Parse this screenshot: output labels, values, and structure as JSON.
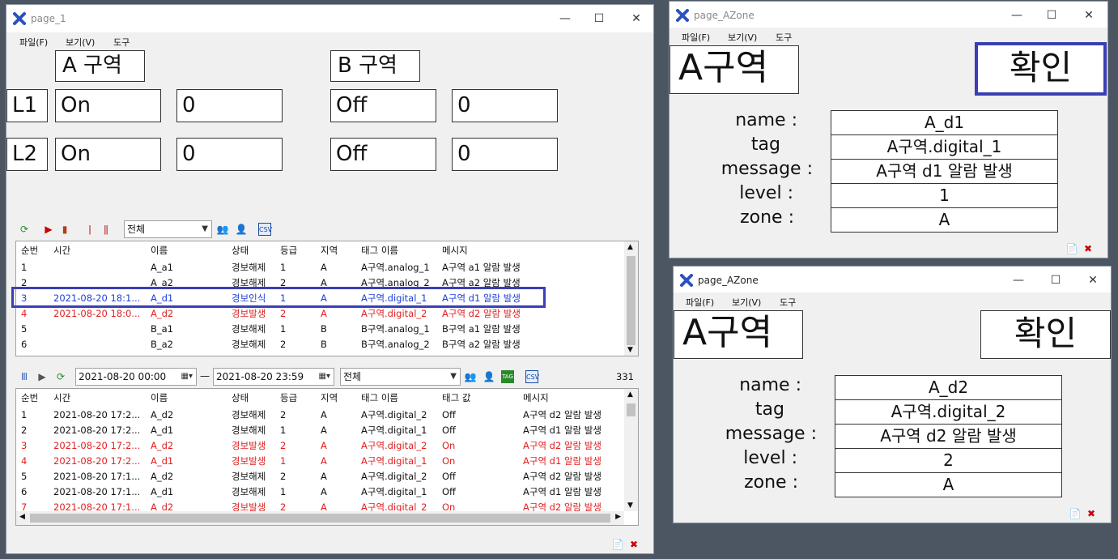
{
  "main_window": {
    "title": "page_1",
    "menu": [
      "파일(F)",
      "보기(V)",
      "도구"
    ],
    "zone_a_label": "A 구역",
    "zone_b_label": "B 구역",
    "rows": [
      {
        "label": "L1",
        "a_state": "On",
        "a_value": "0",
        "b_state": "Off",
        "b_value": "0"
      },
      {
        "label": "L2",
        "a_state": "On",
        "a_value": "0",
        "b_state": "Off",
        "b_value": "0"
      }
    ],
    "alarm_filter": "전체",
    "alarm_columns": [
      "순번",
      "시간",
      "이름",
      "상태",
      "등급",
      "지역",
      "태그 이름",
      "메시지"
    ],
    "alarm_rows": [
      {
        "c": [
          "1",
          "",
          "A_a1",
          "경보해제",
          "1",
          "A",
          "A구역.analog_1",
          "A구역 a1 알람 발생"
        ],
        "style": "normal"
      },
      {
        "c": [
          "2",
          "",
          "A_a2",
          "경보해제",
          "2",
          "A",
          "A구역.analog_2",
          "A구역 a2 알람 발생"
        ],
        "style": "normal"
      },
      {
        "c": [
          "3",
          "2021-08-20 18:1...",
          "A_d1",
          "경보인식",
          "1",
          "A",
          "A구역.digital_1",
          "A구역 d1 알람 발생"
        ],
        "style": "blue"
      },
      {
        "c": [
          "4",
          "2021-08-20 18:0...",
          "A_d2",
          "경보발생",
          "2",
          "A",
          "A구역.digital_2",
          "A구역 d2 알람 발생"
        ],
        "style": "red"
      },
      {
        "c": [
          "5",
          "",
          "B_a1",
          "경보해제",
          "1",
          "B",
          "B구역.analog_1",
          "B구역 a1 알람 발생"
        ],
        "style": "normal"
      },
      {
        "c": [
          "6",
          "",
          "B_a2",
          "경보해제",
          "2",
          "B",
          "B구역.analog_2",
          "B구역 a2 알람 발생"
        ],
        "style": "normal"
      }
    ],
    "history_from": "2021-08-20 00:00",
    "history_to": "2021-08-20 23:59",
    "history_separator": "—",
    "history_filter": "전체",
    "history_count": "331",
    "history_tag_icon": "TAG",
    "history_csv_icon": "CSV",
    "history_columns": [
      "순번",
      "시간",
      "이름",
      "상태",
      "등급",
      "지역",
      "태그 이름",
      "태그 값",
      "메시지"
    ],
    "history_rows": [
      {
        "c": [
          "1",
          "2021-08-20 17:2...",
          "A_d2",
          "경보해제",
          "2",
          "A",
          "A구역.digital_2",
          "Off",
          "A구역 d2 알람 발생"
        ],
        "style": "normal"
      },
      {
        "c": [
          "2",
          "2021-08-20 17:2...",
          "A_d1",
          "경보해제",
          "1",
          "A",
          "A구역.digital_1",
          "Off",
          "A구역 d1 알람 발생"
        ],
        "style": "normal"
      },
      {
        "c": [
          "3",
          "2021-08-20 17:2...",
          "A_d2",
          "경보발생",
          "2",
          "A",
          "A구역.digital_2",
          "On",
          "A구역 d2 알람 발생"
        ],
        "style": "red"
      },
      {
        "c": [
          "4",
          "2021-08-20 17:2...",
          "A_d1",
          "경보발생",
          "1",
          "A",
          "A구역.digital_1",
          "On",
          "A구역 d1 알람 발생"
        ],
        "style": "red"
      },
      {
        "c": [
          "5",
          "2021-08-20 17:1...",
          "A_d2",
          "경보해제",
          "2",
          "A",
          "A구역.digital_2",
          "Off",
          "A구역 d2 알람 발생"
        ],
        "style": "normal"
      },
      {
        "c": [
          "6",
          "2021-08-20 17:1...",
          "A_d1",
          "경보해제",
          "1",
          "A",
          "A구역.digital_1",
          "Off",
          "A구역 d1 알람 발생"
        ],
        "style": "normal"
      },
      {
        "c": [
          "7",
          "2021-08-20 17:1...",
          "A_d2",
          "경보발생",
          "2",
          "A",
          "A구역.digital_2",
          "On",
          "A구역 d2 알람 발생"
        ],
        "style": "red"
      }
    ]
  },
  "azone1": {
    "title": "page_AZone",
    "menu": [
      "파일(F)",
      "보기(V)",
      "도구"
    ],
    "zone_label": "A구역",
    "confirm": "확인",
    "fields": [
      {
        "label": "name :",
        "value": "A_d1"
      },
      {
        "label": "tag",
        "value": "A구역.digital_1"
      },
      {
        "label": "message :",
        "value": "A구역 d1 알람 발생"
      },
      {
        "label": "level :",
        "value": "1"
      },
      {
        "label": "zone :",
        "value": "A"
      }
    ]
  },
  "azone2": {
    "title": "page_AZone",
    "menu": [
      "파일(F)",
      "보기(V)",
      "도구"
    ],
    "zone_label": "A구역",
    "confirm": "확인",
    "fields": [
      {
        "label": "name :",
        "value": "A_d2"
      },
      {
        "label": "tag",
        "value": "A구역.digital_2"
      },
      {
        "label": "message :",
        "value": "A구역 d2 알람 발생"
      },
      {
        "label": "level :",
        "value": "2"
      },
      {
        "label": "zone :",
        "value": "A"
      }
    ]
  },
  "window_controls": {
    "minimize": "—",
    "maximize": "☐",
    "close": "✕"
  },
  "colors": {
    "accent_highlight": "#3a3fb5",
    "alarm_red": "#e02020",
    "ack_blue": "#1f3fd8"
  }
}
